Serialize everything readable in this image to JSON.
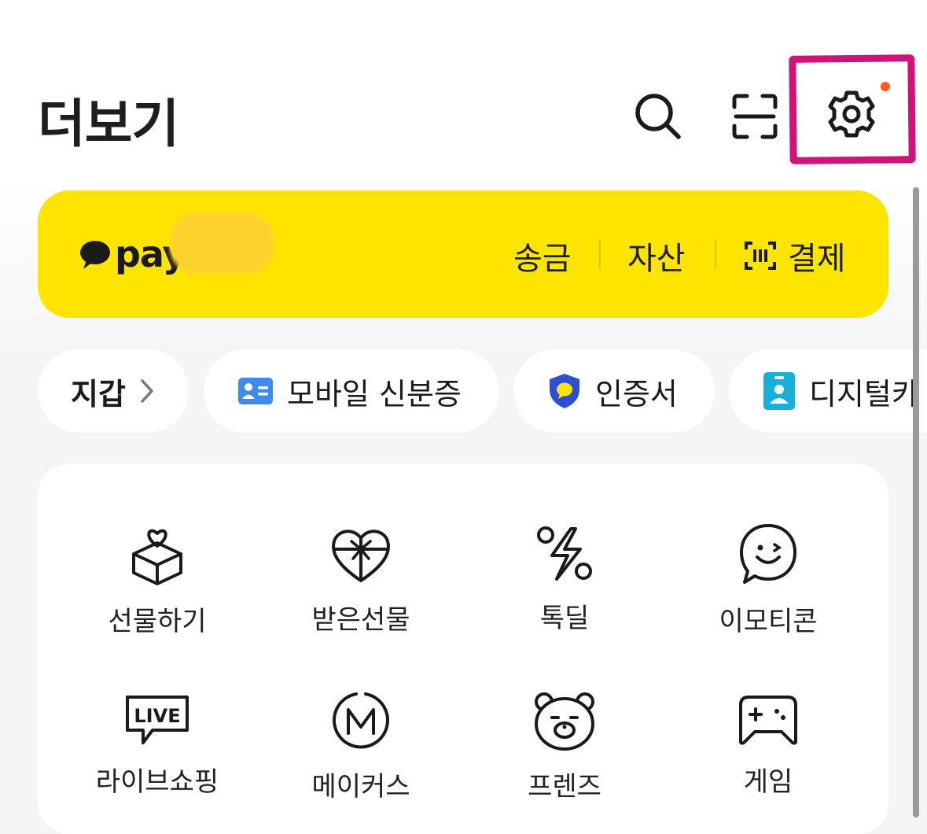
{
  "header": {
    "title": "더보기",
    "icons": [
      "search-icon",
      "scan-icon",
      "gear-icon"
    ],
    "settings_badge_color": "#ff5a1f",
    "highlight_color": "#d0127a"
  },
  "pay": {
    "logo_text": "pay",
    "bg_color": "#fee500",
    "actions": [
      {
        "label": "송금"
      },
      {
        "label": "자산"
      },
      {
        "label": "결제",
        "icon": "barcode-icon"
      }
    ]
  },
  "chips": [
    {
      "label": "지갑",
      "icon": "chevron-right-icon"
    },
    {
      "label": "모바일 신분증",
      "icon": "id-card-icon"
    },
    {
      "label": "인증서",
      "icon": "shield-icon"
    },
    {
      "label": "디지털카",
      "icon": "badge-icon"
    }
  ],
  "menu": {
    "items": [
      {
        "label": "선물하기",
        "icon": "gift-box-icon"
      },
      {
        "label": "받은선물",
        "icon": "heart-gift-icon"
      },
      {
        "label": "톡딜",
        "icon": "discount-icon"
      },
      {
        "label": "이모티콘",
        "icon": "emoticon-icon"
      },
      {
        "label": "라이브쇼핑",
        "icon": "live-icon"
      },
      {
        "label": "메이커스",
        "icon": "makers-icon"
      },
      {
        "label": "프렌즈",
        "icon": "friends-bear-icon"
      },
      {
        "label": "게임",
        "icon": "gamepad-icon"
      }
    ]
  }
}
